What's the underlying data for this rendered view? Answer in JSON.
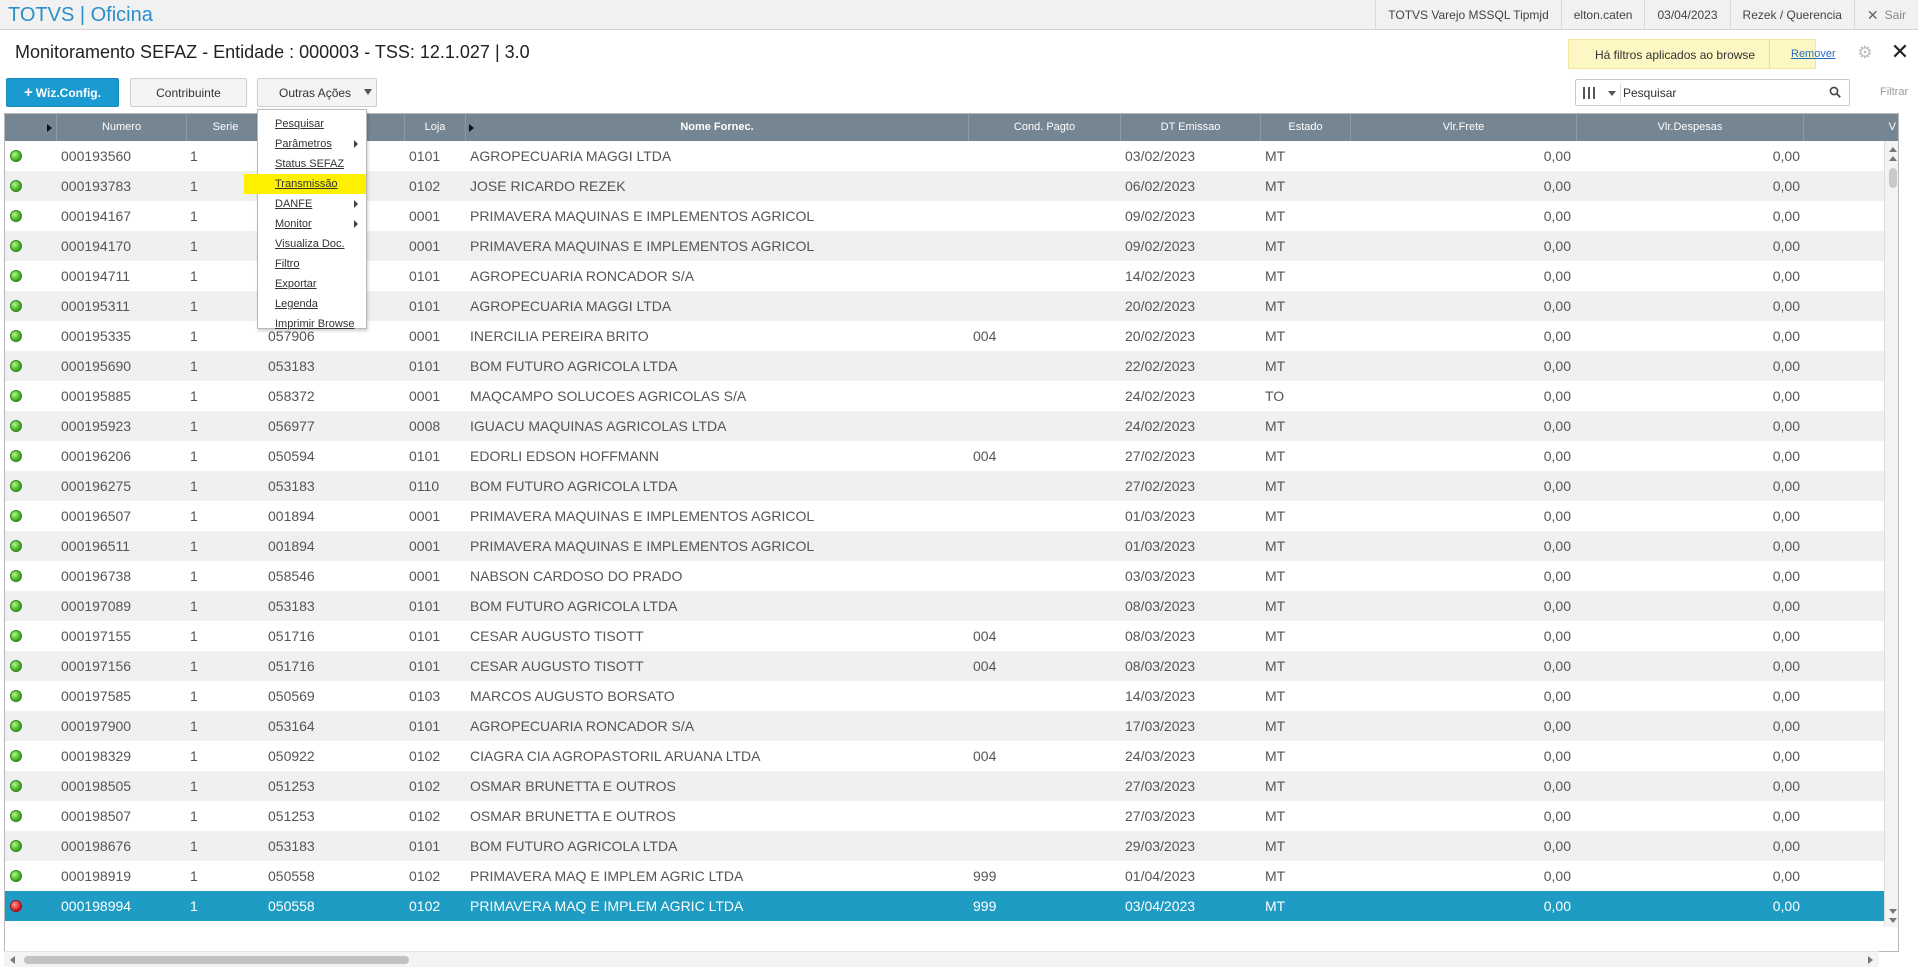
{
  "app": {
    "brand": "TOTVS | Oficina",
    "top_items": [
      "TOTVS Varejo MSSQL Tipmjd",
      "elton.caten",
      "03/04/2023",
      "Rezek / Querencia"
    ],
    "exit_label": "Sair"
  },
  "page": {
    "title": "Monitoramento SEFAZ - Entidade : 000003 - TSS: 12.1.027 | 3.0",
    "filter_note": "Há filtros aplicados ao browse",
    "filter_remove": "Remover"
  },
  "toolbar": {
    "wiz_label": "Wiz.Config.",
    "contrib_label": "Contribuinte",
    "outras_label": "Outras Ações",
    "search_placeholder": "Pesquisar",
    "filtrar_label": "Filtrar"
  },
  "menu": {
    "items": [
      {
        "label": "Pesquisar",
        "submenu": false,
        "highlight": false
      },
      {
        "label": "Parâmetros",
        "submenu": true,
        "highlight": false
      },
      {
        "label": "Status SEFAZ",
        "submenu": false,
        "highlight": false
      },
      {
        "label": "Transmissão",
        "submenu": false,
        "highlight": true
      },
      {
        "label": "DANFE",
        "submenu": true,
        "highlight": false
      },
      {
        "label": "Monitor",
        "submenu": true,
        "highlight": false
      },
      {
        "label": "Visualiza Doc.",
        "submenu": false,
        "highlight": false
      },
      {
        "label": "Filtro",
        "submenu": false,
        "highlight": false
      },
      {
        "label": "Exportar",
        "submenu": false,
        "highlight": false
      },
      {
        "label": "Legenda",
        "submenu": false,
        "highlight": false
      },
      {
        "label": "Imprimir Browse",
        "submenu": false,
        "highlight": false
      }
    ]
  },
  "table": {
    "columns": [
      "Numero",
      "Serie",
      "",
      "Loja",
      "Nome Fornec.",
      "Cond. Pagto",
      "DT Emissao",
      "Estado",
      "Vlr.Frete",
      "Vlr.Despesas",
      "V"
    ],
    "rows": [
      {
        "status": "green",
        "numero": "000193560",
        "serie": "1",
        "cliente": "",
        "loja": "0101",
        "nome": "AGROPECUARIA MAGGI LTDA",
        "cond": "",
        "dt": "03/02/2023",
        "uf": "MT",
        "frete": "0,00",
        "desp": "0,00"
      },
      {
        "status": "green",
        "numero": "000193783",
        "serie": "1",
        "cliente": "",
        "loja": "0102",
        "nome": "JOSE RICARDO REZEK",
        "cond": "",
        "dt": "06/02/2023",
        "uf": "MT",
        "frete": "0,00",
        "desp": "0,00"
      },
      {
        "status": "green",
        "numero": "000194167",
        "serie": "1",
        "cliente": "",
        "loja": "0001",
        "nome": "PRIMAVERA MAQUINAS E IMPLEMENTOS AGRICOL",
        "cond": "",
        "dt": "09/02/2023",
        "uf": "MT",
        "frete": "0,00",
        "desp": "0,00"
      },
      {
        "status": "green",
        "numero": "000194170",
        "serie": "1",
        "cliente": "",
        "loja": "0001",
        "nome": "PRIMAVERA MAQUINAS E IMPLEMENTOS AGRICOL",
        "cond": "",
        "dt": "09/02/2023",
        "uf": "MT",
        "frete": "0,00",
        "desp": "0,00"
      },
      {
        "status": "green",
        "numero": "000194711",
        "serie": "1",
        "cliente": "",
        "loja": "0101",
        "nome": "AGROPECUARIA RONCADOR S/A",
        "cond": "",
        "dt": "14/02/2023",
        "uf": "MT",
        "frete": "0,00",
        "desp": "0,00"
      },
      {
        "status": "green",
        "numero": "000195311",
        "serie": "1",
        "cliente": "",
        "loja": "0101",
        "nome": "AGROPECUARIA MAGGI LTDA",
        "cond": "",
        "dt": "20/02/2023",
        "uf": "MT",
        "frete": "0,00",
        "desp": "0,00"
      },
      {
        "status": "green",
        "numero": "000195335",
        "serie": "1",
        "cliente": "057906",
        "loja": "0001",
        "nome": "INERCILIA PEREIRA BRITO",
        "cond": "004",
        "dt": "20/02/2023",
        "uf": "MT",
        "frete": "0,00",
        "desp": "0,00"
      },
      {
        "status": "green",
        "numero": "000195690",
        "serie": "1",
        "cliente": "053183",
        "loja": "0101",
        "nome": "BOM FUTURO AGRICOLA LTDA",
        "cond": "",
        "dt": "22/02/2023",
        "uf": "MT",
        "frete": "0,00",
        "desp": "0,00"
      },
      {
        "status": "green",
        "numero": "000195885",
        "serie": "1",
        "cliente": "058372",
        "loja": "0001",
        "nome": "MAQCAMPO SOLUCOES AGRICOLAS S/A",
        "cond": "",
        "dt": "24/02/2023",
        "uf": "TO",
        "frete": "0,00",
        "desp": "0,00"
      },
      {
        "status": "green",
        "numero": "000195923",
        "serie": "1",
        "cliente": "056977",
        "loja": "0008",
        "nome": "IGUACU MAQUINAS AGRICOLAS LTDA",
        "cond": "",
        "dt": "24/02/2023",
        "uf": "MT",
        "frete": "0,00",
        "desp": "0,00"
      },
      {
        "status": "green",
        "numero": "000196206",
        "serie": "1",
        "cliente": "050594",
        "loja": "0101",
        "nome": "EDORLI EDSON HOFFMANN",
        "cond": "004",
        "dt": "27/02/2023",
        "uf": "MT",
        "frete": "0,00",
        "desp": "0,00"
      },
      {
        "status": "green",
        "numero": "000196275",
        "serie": "1",
        "cliente": "053183",
        "loja": "0110",
        "nome": "BOM FUTURO AGRICOLA LTDA",
        "cond": "",
        "dt": "27/02/2023",
        "uf": "MT",
        "frete": "0,00",
        "desp": "0,00"
      },
      {
        "status": "green",
        "numero": "000196507",
        "serie": "1",
        "cliente": "001894",
        "loja": "0001",
        "nome": "PRIMAVERA MAQUINAS E IMPLEMENTOS AGRICOL",
        "cond": "",
        "dt": "01/03/2023",
        "uf": "MT",
        "frete": "0,00",
        "desp": "0,00"
      },
      {
        "status": "green",
        "numero": "000196511",
        "serie": "1",
        "cliente": "001894",
        "loja": "0001",
        "nome": "PRIMAVERA MAQUINAS E IMPLEMENTOS AGRICOL",
        "cond": "",
        "dt": "01/03/2023",
        "uf": "MT",
        "frete": "0,00",
        "desp": "0,00"
      },
      {
        "status": "green",
        "numero": "000196738",
        "serie": "1",
        "cliente": "058546",
        "loja": "0001",
        "nome": "NABSON CARDOSO DO PRADO",
        "cond": "",
        "dt": "03/03/2023",
        "uf": "MT",
        "frete": "0,00",
        "desp": "0,00"
      },
      {
        "status": "green",
        "numero": "000197089",
        "serie": "1",
        "cliente": "053183",
        "loja": "0101",
        "nome": "BOM FUTURO AGRICOLA LTDA",
        "cond": "",
        "dt": "08/03/2023",
        "uf": "MT",
        "frete": "0,00",
        "desp": "0,00"
      },
      {
        "status": "green",
        "numero": "000197155",
        "serie": "1",
        "cliente": "051716",
        "loja": "0101",
        "nome": "CESAR AUGUSTO TISOTT",
        "cond": "004",
        "dt": "08/03/2023",
        "uf": "MT",
        "frete": "0,00",
        "desp": "0,00"
      },
      {
        "status": "green",
        "numero": "000197156",
        "serie": "1",
        "cliente": "051716",
        "loja": "0101",
        "nome": "CESAR AUGUSTO TISOTT",
        "cond": "004",
        "dt": "08/03/2023",
        "uf": "MT",
        "frete": "0,00",
        "desp": "0,00"
      },
      {
        "status": "green",
        "numero": "000197585",
        "serie": "1",
        "cliente": "050569",
        "loja": "0103",
        "nome": "MARCOS AUGUSTO BORSATO",
        "cond": "",
        "dt": "14/03/2023",
        "uf": "MT",
        "frete": "0,00",
        "desp": "0,00"
      },
      {
        "status": "green",
        "numero": "000197900",
        "serie": "1",
        "cliente": "053164",
        "loja": "0101",
        "nome": "AGROPECUARIA RONCADOR S/A",
        "cond": "",
        "dt": "17/03/2023",
        "uf": "MT",
        "frete": "0,00",
        "desp": "0,00"
      },
      {
        "status": "green",
        "numero": "000198329",
        "serie": "1",
        "cliente": "050922",
        "loja": "0102",
        "nome": "CIAGRA CIA AGROPASTORIL ARUANA LTDA",
        "cond": "004",
        "dt": "24/03/2023",
        "uf": "MT",
        "frete": "0,00",
        "desp": "0,00"
      },
      {
        "status": "green",
        "numero": "000198505",
        "serie": "1",
        "cliente": "051253",
        "loja": "0102",
        "nome": "OSMAR BRUNETTA E OUTROS",
        "cond": "",
        "dt": "27/03/2023",
        "uf": "MT",
        "frete": "0,00",
        "desp": "0,00"
      },
      {
        "status": "green",
        "numero": "000198507",
        "serie": "1",
        "cliente": "051253",
        "loja": "0102",
        "nome": "OSMAR BRUNETTA E OUTROS",
        "cond": "",
        "dt": "27/03/2023",
        "uf": "MT",
        "frete": "0,00",
        "desp": "0,00"
      },
      {
        "status": "green",
        "numero": "000198676",
        "serie": "1",
        "cliente": "053183",
        "loja": "0101",
        "nome": "BOM FUTURO AGRICOLA LTDA",
        "cond": "",
        "dt": "29/03/2023",
        "uf": "MT",
        "frete": "0,00",
        "desp": "0,00"
      },
      {
        "status": "green",
        "numero": "000198919",
        "serie": "1",
        "cliente": "050558",
        "loja": "0102",
        "nome": "PRIMAVERA MAQ E IMPLEM AGRIC LTDA",
        "cond": "999",
        "dt": "01/04/2023",
        "uf": "MT",
        "frete": "0,00",
        "desp": "0,00"
      },
      {
        "status": "red",
        "numero": "000198994",
        "serie": "1",
        "cliente": "050558",
        "loja": "0102",
        "nome": "PRIMAVERA MAQ E IMPLEM AGRIC LTDA",
        "cond": "999",
        "dt": "03/04/2023",
        "uf": "MT",
        "frete": "0,00",
        "desp": "0,00",
        "selected": true
      }
    ]
  },
  "colors": {
    "brand": "#2a8fc8",
    "primary_button": "#1a9ad0",
    "header_bg": "#758592",
    "selected_row": "#1e9cc3",
    "menu_highlight": "#fef100"
  }
}
